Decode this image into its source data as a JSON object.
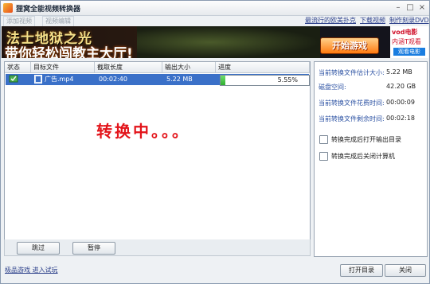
{
  "window": {
    "title": "狸窝全能视频转换器"
  },
  "toolbar": {
    "add_label": "添加视频",
    "edit_label": "视频编辑",
    "links": [
      "最流行的欧美扑克",
      "下载视频",
      "制作刻录DVD"
    ]
  },
  "ad": {
    "line1": "法士地狱之光",
    "line2": "带你轻松闯教主大厅!",
    "play_label": "开始游戏",
    "brand": "vod电影",
    "brand_sub": "内涵T观看",
    "watch_label": "观看电影"
  },
  "table": {
    "columns": [
      "状态",
      "目标文件",
      "截取长度",
      "输出大小",
      "进度"
    ],
    "rows": [
      {
        "file": "广告.mp4",
        "duration": "00:02:40",
        "size": "5.22 MB",
        "progress": 0.0555,
        "progress_text": "5.55%"
      }
    ]
  },
  "converting_text": "转换中。。。",
  "controls": {
    "skip_label": "跳过",
    "pause_label": "暂停"
  },
  "stats": [
    {
      "label": "当前转换文件估计大小:",
      "value": "5.22 MB"
    },
    {
      "label": "磁盘空间:",
      "value": "42.20 GB"
    },
    {
      "label": "当前转换文件花费时间:",
      "value": "00:00:09"
    },
    {
      "label": "当前转换文件剩余时间:",
      "value": "00:02:18"
    }
  ],
  "options": [
    {
      "label": "转换完成后打开输出目录",
      "checked": false
    },
    {
      "label": "转换完成后关闭计算机",
      "checked": false
    }
  ],
  "footer": {
    "link": "极品游戏 进入试玩",
    "open_dir_label": "打开目录",
    "close_label": "关闭"
  }
}
